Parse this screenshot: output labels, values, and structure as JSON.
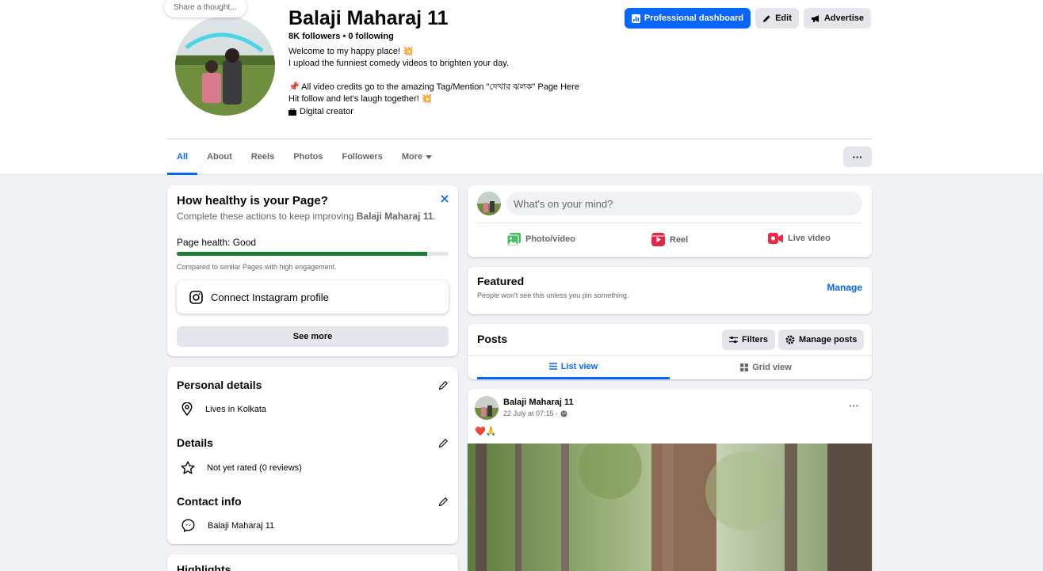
{
  "header": {
    "share_thought": "Share a thought...",
    "page_name": "Balaji Maharaj 11",
    "stats": "8K followers • 0 following",
    "bio_lines": [
      "Welcome to my happy place! 💥",
      "I upload the funniest comedy videos to brighten your day.",
      "",
      "📌 All video credits go to the amazing Tag/Mention \"দেখার ঝলক\" Page Here",
      "Hit follow and let's laugh together! 💥"
    ],
    "category": "Digital creator",
    "buttons": {
      "dashboard": "Professional dashboard",
      "edit": "Edit",
      "advertise": "Advertise"
    }
  },
  "tabs": [
    "All",
    "About",
    "Reels",
    "Photos",
    "Followers",
    "More"
  ],
  "more_menu_label": "···",
  "health": {
    "title": "How healthy is your Page?",
    "subtitle_prefix": "Complete these actions to keep improving ",
    "subtitle_page": "Balaji Maharaj 11",
    "subtitle_suffix": ".",
    "status": "Page health: Good",
    "progress": 0.92,
    "compare": "Compared to similar Pages with high engagement.",
    "instagram": "Connect Instagram profile",
    "see_more": "See more",
    "bar_color": "#1b7e34"
  },
  "about": {
    "personal_title": "Personal details",
    "lives": "Lives in Kolkata",
    "details_title": "Details",
    "rating": "Not yet rated (0 reviews)",
    "contact_title": "Contact info",
    "messenger": "Balaji Maharaj 11",
    "highlights_title": "Highlights"
  },
  "composer": {
    "placeholder": "What's on your mind?",
    "photo": "Photo/video",
    "reel": "Reel",
    "live": "Live video"
  },
  "featured": {
    "title": "Featured",
    "subtitle": "People won't see this unless you pin something.",
    "manage": "Manage"
  },
  "posts": {
    "title": "Posts",
    "filters": "Filters",
    "manage": "Manage posts",
    "list_view": "List view",
    "grid_view": "Grid view"
  },
  "post": {
    "author": "Balaji Maharaj 11",
    "time": "22 July at 07:15 ·",
    "caption": "❤️🙏"
  },
  "colors": {
    "accent": "#0866ff",
    "background": "#f0f2f5"
  }
}
